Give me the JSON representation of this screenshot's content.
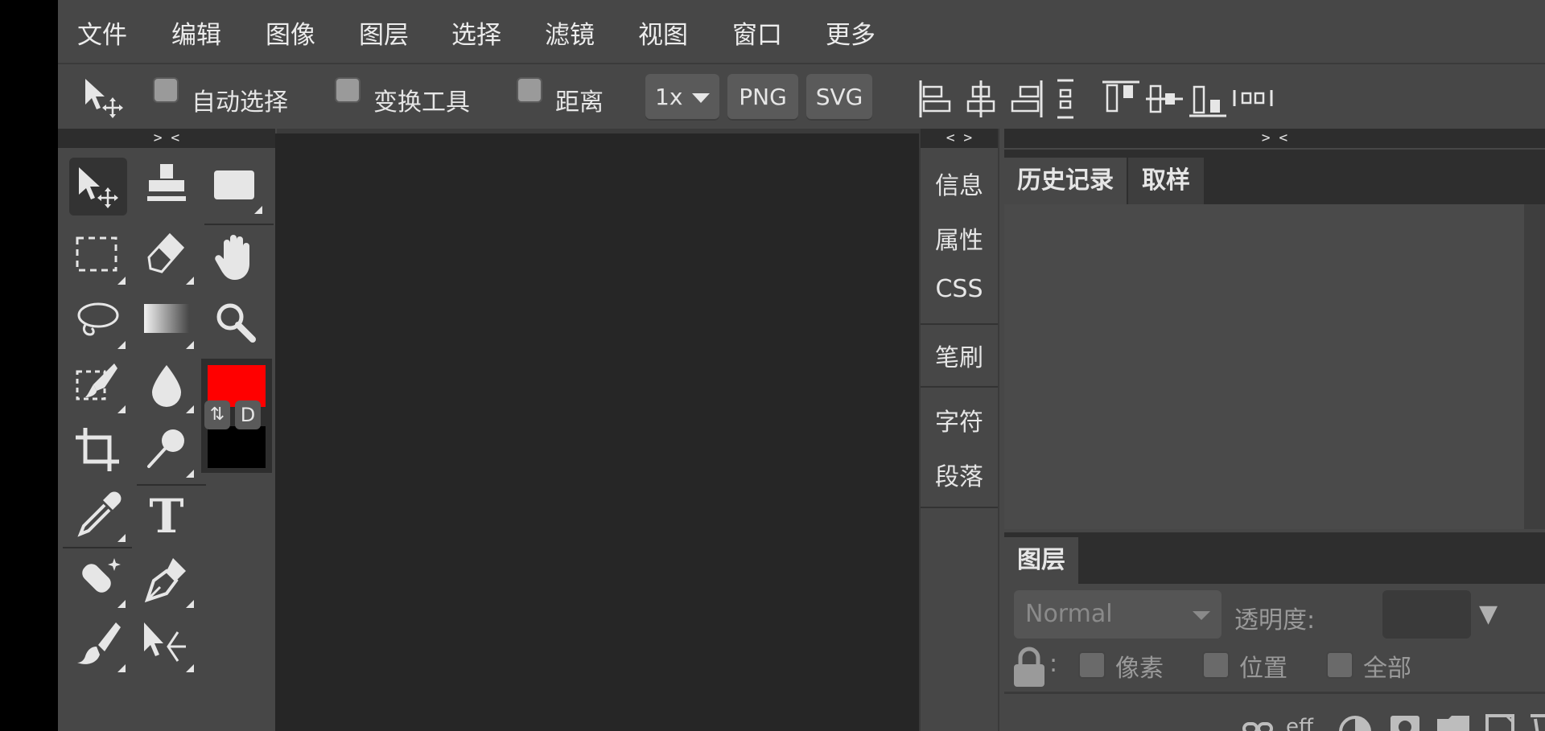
{
  "menu": {
    "items": [
      "文件",
      "编辑",
      "图像",
      "图层",
      "选择",
      "滤镜",
      "视图",
      "窗口",
      "更多"
    ]
  },
  "options": {
    "auto_select": "自动选择",
    "transform_tools": "变换工具",
    "distance": "距离",
    "scale_label": "1x",
    "png_label": "PNG",
    "svg_label": "SVG",
    "move_icon": "move-tool-icon",
    "align_icons": [
      "align-left-icon",
      "align-center-h-icon",
      "align-right-icon",
      "distribute-h-icon",
      "align-top-icon",
      "align-middle-v-icon",
      "align-bottom-icon",
      "distribute-v-icon"
    ]
  },
  "toolbox": {
    "collapse_label": "> <",
    "foreground_color": "#ff0000",
    "background_color": "#000000",
    "swap_label": "⇅",
    "default_label": "D",
    "tools": [
      "move-tool-icon",
      "stamp-tool-icon",
      "shape-tool-icon",
      "marquee-tool-icon",
      "eraser-tool-icon",
      "hand-tool-icon",
      "lasso-tool-icon",
      "gradient-tool-icon",
      "zoom-tool-icon",
      "quick-select-tool-icon",
      "blur-tool-icon",
      "crop-tool-icon",
      "smudge-tool-icon",
      "eyedropper-tool-icon",
      "text-tool-icon",
      "healing-tool-icon",
      "pen-tool-icon",
      "brush-tool-icon",
      "path-select-tool-icon"
    ],
    "text_tool_label": "T"
  },
  "iconstrip": {
    "collapse_label": "< >",
    "items": [
      "信息",
      "属性",
      "CSS",
      "笔刷",
      "字符",
      "段落"
    ]
  },
  "rightpanel": {
    "collapse_label": "> <",
    "tabs": [
      "历史记录",
      "取样"
    ],
    "layers_tab": "图层",
    "blend_mode": "Normal",
    "opacity_label": "透明度:",
    "opacity_arrow": "▼",
    "lock_colon": ":",
    "lock_pixels": "像素",
    "lock_position": "位置",
    "lock_all": "全部",
    "eff_label": "eff"
  }
}
